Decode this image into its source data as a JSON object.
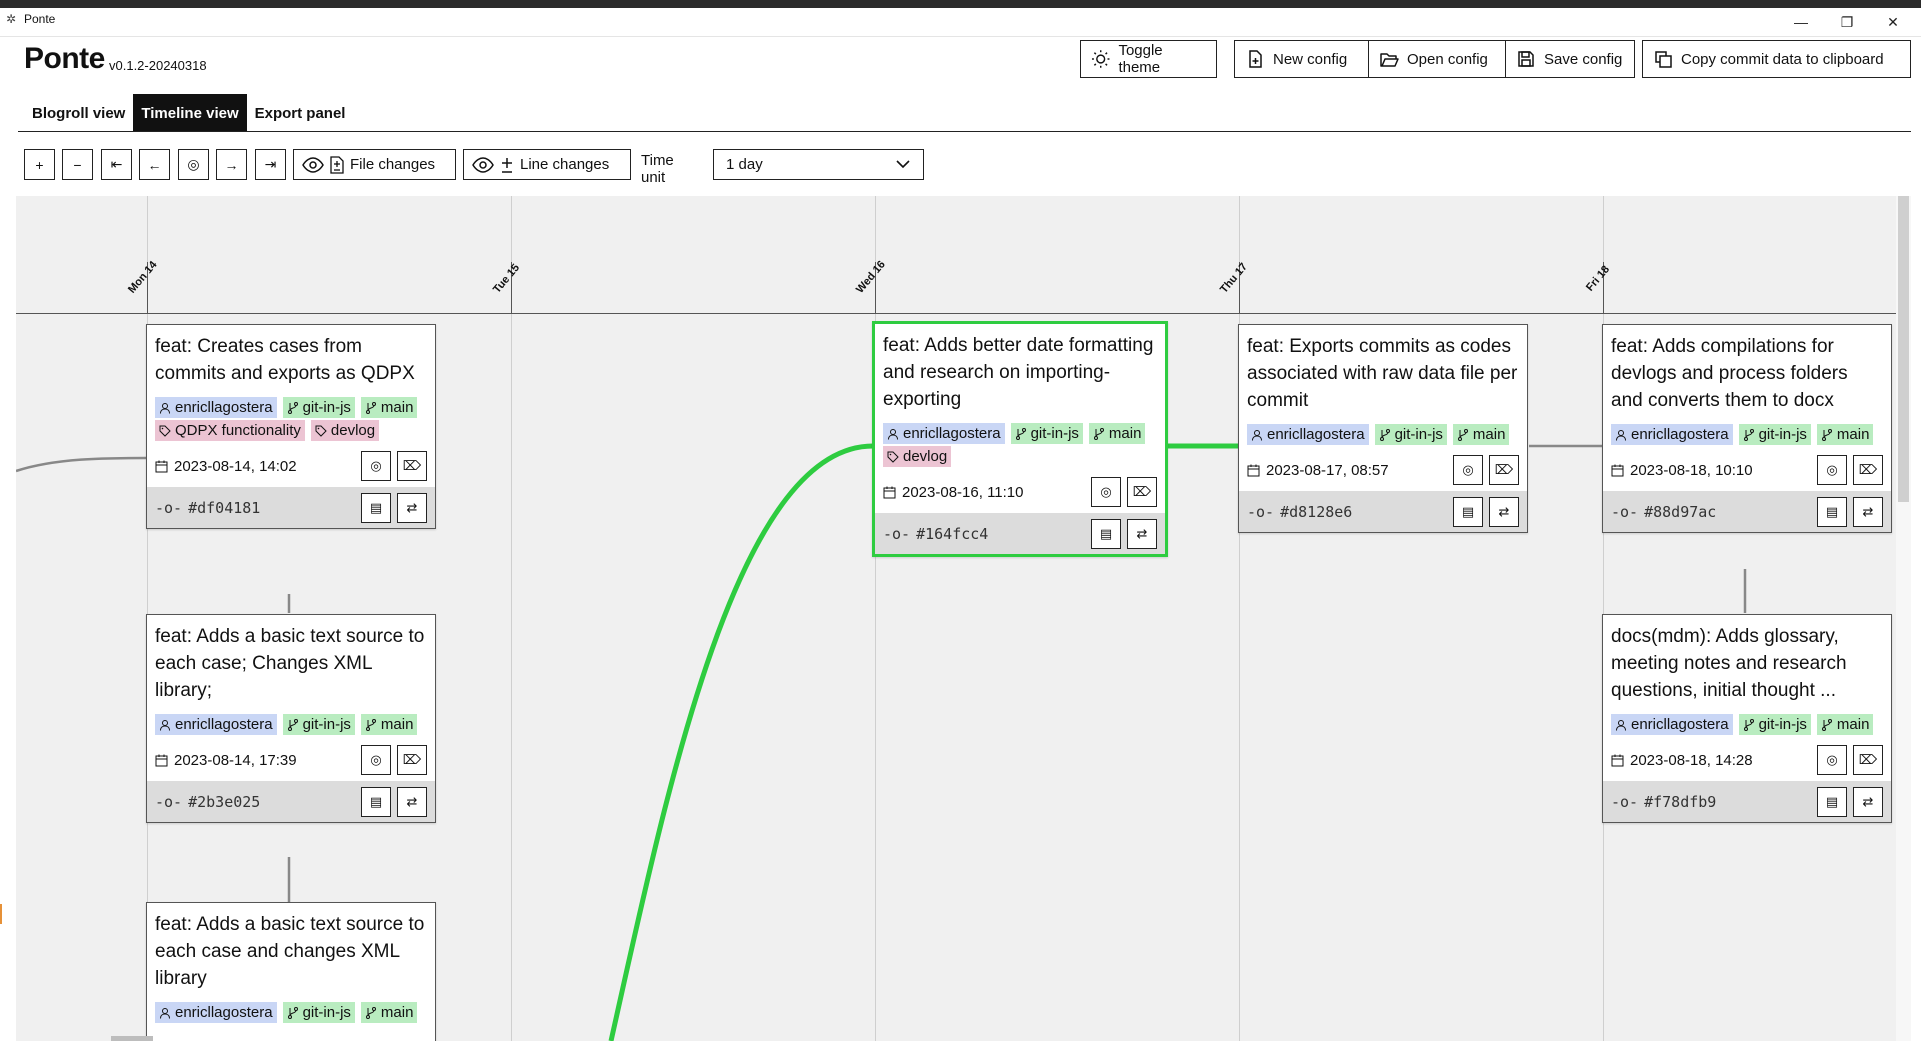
{
  "window": {
    "title": "Ponte"
  },
  "app": {
    "name": "Ponte",
    "version": "v0.1.2-20240318"
  },
  "toolbar": {
    "toggle_theme": "Toggle theme",
    "new_config": "New config",
    "open_config": "Open config",
    "save_config": "Save config",
    "copy_commit": "Copy commit data to clipboard"
  },
  "tabs": [
    {
      "label": "Blogroll view",
      "active": false
    },
    {
      "label": "Timeline view",
      "active": true
    },
    {
      "label": "Export panel",
      "active": false
    }
  ],
  "controls": {
    "zoom_in": "+",
    "zoom_out": "−",
    "first": "⇤",
    "prev": "←",
    "center": "◎",
    "next": "→",
    "last": "⇥",
    "file_changes": "File changes",
    "line_changes": "Line changes",
    "time_unit_label": "Time unit",
    "time_unit_value": "1 day"
  },
  "days": [
    "Mon 14",
    "Tue 15",
    "Wed 16",
    "Thu 17",
    "Fri 18"
  ],
  "colors": {
    "selected": "#2ecc40",
    "author": "#c9d6f5",
    "branch": "#b9ecc0",
    "label": "#ecc4d3"
  },
  "cards": [
    {
      "title": "feat: Creates cases from commits and exports as QDPX",
      "author": "enricllagostera",
      "branch1": "git-in-js",
      "branch2": "main",
      "label1": "QDPX functionality",
      "label2": "devlog",
      "date": "2023-08-14, 14:02",
      "hash": "#df04181"
    },
    {
      "title": "feat: Adds a basic text source to each case; Changes XML library;",
      "author": "enricllagostera",
      "branch1": "git-in-js",
      "branch2": "main",
      "date": "2023-08-14, 17:39",
      "hash": "#2b3e025"
    },
    {
      "title": "feat: Adds a basic text source to each case and changes XML library",
      "author": "enricllagostera",
      "branch1": "git-in-js",
      "branch2": "main"
    },
    {
      "title": "feat: Adds better date formatting and research on importing-exporting",
      "author": "enricllagostera",
      "branch1": "git-in-js",
      "branch2": "main",
      "label1": "devlog",
      "date": "2023-08-16, 11:10",
      "hash": "#164fcc4"
    },
    {
      "title": "feat: Exports commits as codes associated with raw data file per commit",
      "author": "enricllagostera",
      "branch1": "git-in-js",
      "branch2": "main",
      "date": "2023-08-17, 08:57",
      "hash": "#d8128e6"
    },
    {
      "title": "feat: Adds compilations for devlogs and process folders and converts them to docx",
      "author": "enricllagostera",
      "branch1": "git-in-js",
      "branch2": "main",
      "date": "2023-08-18, 10:10",
      "hash": "#88d97ac"
    },
    {
      "title": "docs(mdm): Adds glossary, meeting notes and research questions, initial thought ...",
      "author": "enricllagostera",
      "branch1": "git-in-js",
      "branch2": "main",
      "date": "2023-08-18, 14:28",
      "hash": "#f78dfb9"
    }
  ]
}
